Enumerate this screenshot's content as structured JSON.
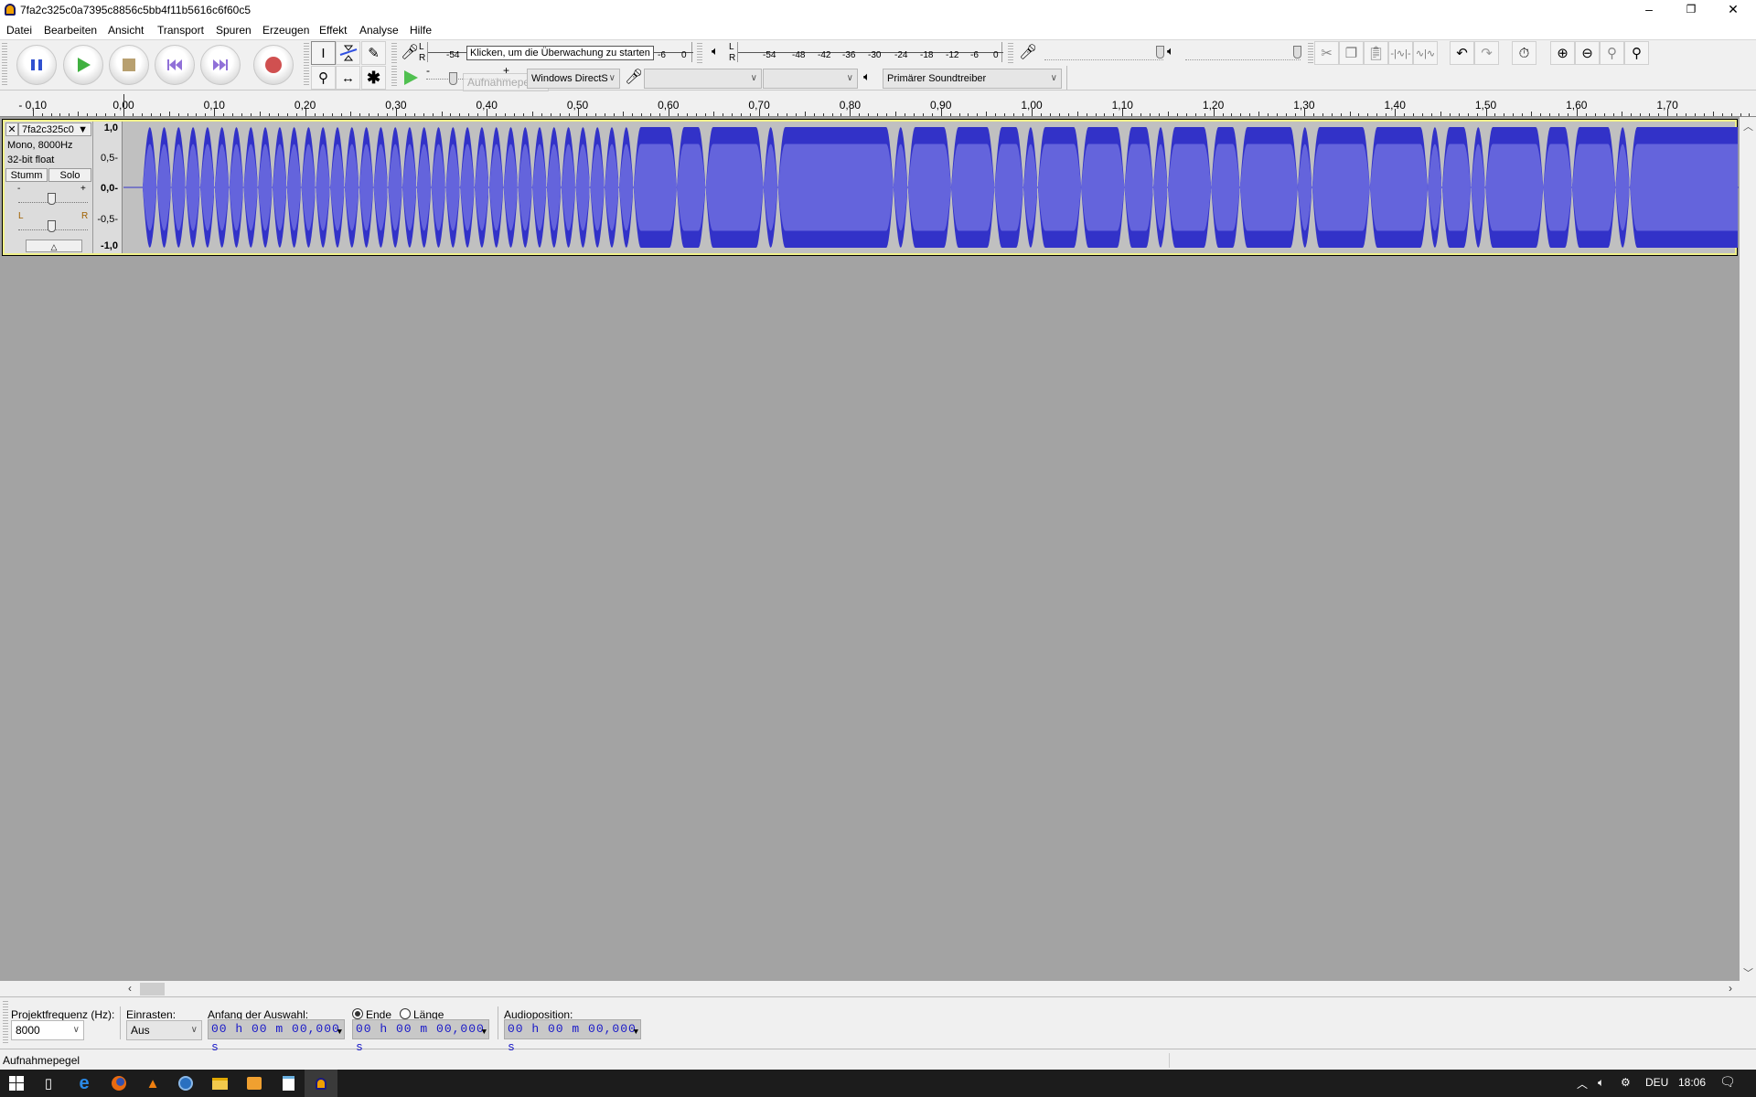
{
  "window": {
    "title": "7fa2c325c0a7395c8856c5bb4f11b5616c6f60c5",
    "minimize": "–",
    "restore": "❐",
    "close": "✕"
  },
  "menu": [
    "Datei",
    "Bearbeiten",
    "Ansicht",
    "Transport",
    "Spuren",
    "Erzeugen",
    "Effekt",
    "Analyse",
    "Hilfe"
  ],
  "transport": {
    "pause": "pause-icon",
    "play": "play-icon",
    "stop": "stop-icon",
    "skip_start": "skip-start-icon",
    "skip_end": "skip-end-icon",
    "record": "record-icon"
  },
  "record_meter": {
    "l": "L",
    "r": "R",
    "ticks": [
      "-54",
      "-6",
      "0"
    ],
    "tooltip": "Klicken, um die Überwachung zu starten"
  },
  "play_meter": {
    "l": "L",
    "r": "R",
    "ticks": [
      "-54",
      "-48",
      "-42",
      "-36",
      "-30",
      "-24",
      "-18",
      "-12",
      "-6",
      "0"
    ]
  },
  "playspeed": {
    "minus": "-",
    "plus": "+",
    "ghost_tooltip": "Aufnahmepegel"
  },
  "device": {
    "host": "Windows DirectS",
    "input": "",
    "channels": "",
    "output": "Primärer Soundtreiber"
  },
  "mixer": {
    "record_volume": 1.0,
    "playback_volume": 1.0
  },
  "ruler": {
    "labels": [
      "- 0,10",
      "0,00",
      "0,10",
      "0,20",
      "0,30",
      "0,40",
      "0,50",
      "0,60",
      "0,70",
      "0,80",
      "0,90",
      "1,00",
      "1,10",
      "1,20",
      "1,30",
      "1,40",
      "1,50",
      "1,60",
      "1,70"
    ],
    "values": [
      -0.1,
      0,
      0.1,
      0.2,
      0.3,
      0.4,
      0.5,
      0.6,
      0.7,
      0.8,
      0.9,
      1.0,
      1.1,
      1.2,
      1.3,
      1.4,
      1.5,
      1.6,
      1.7
    ]
  },
  "track": {
    "name": "7fa2c325c0",
    "info1": "Mono, 8000Hz",
    "info2": "32-bit float",
    "mute": "Stumm",
    "solo": "Solo",
    "gain_minus": "-",
    "gain_plus": "+",
    "pan_l": "L",
    "pan_r": "R",
    "vruler": [
      "1,0",
      "0,5-",
      "0,0-",
      "-0,5-",
      "-1,0"
    ],
    "colors": {
      "peak": "#3232c8",
      "rms": "#6464dc",
      "background": "#c0c0c0"
    },
    "waveform": {
      "start_s": 0.021,
      "pulse_s": 0.0159,
      "pulses": [
        1,
        1,
        1,
        1,
        1,
        1,
        1,
        1,
        1,
        1,
        1,
        1,
        1,
        1,
        1,
        1,
        1,
        1,
        1,
        1,
        1,
        1,
        1,
        1,
        1,
        1,
        1,
        1,
        1,
        1,
        1,
        1,
        1,
        1,
        3,
        2,
        4,
        1,
        8,
        1,
        3,
        3,
        2,
        1,
        3,
        3,
        2,
        1,
        3,
        2,
        4,
        1,
        4,
        4,
        1,
        2,
        1,
        4,
        2,
        3,
        1,
        9
      ]
    }
  },
  "selection": {
    "rate_label": "Projektfrequenz (Hz):",
    "rate": "8000",
    "snap_label": "Einrasten:",
    "snap": "Aus",
    "start_label": "Anfang der Auswahl:",
    "end_label": "Ende",
    "length_label": "Länge",
    "end_selected": true,
    "audiopos_label": "Audioposition:",
    "time_start": "00 h 00 m 00,000 s",
    "time_end": "00 h 00 m 00,000 s",
    "time_pos": "00 h 00 m 00,000 s"
  },
  "status": "Aufnahmepegel",
  "taskbar": {
    "apps": [
      "task-view-icon",
      "edge-icon",
      "firefox-icon",
      "vlc-icon",
      "thunderbird-icon",
      "file-explorer-icon",
      "photos-icon",
      "notepad-icon",
      "audacity-icon"
    ],
    "lang": "DEU",
    "time": "18:06"
  }
}
